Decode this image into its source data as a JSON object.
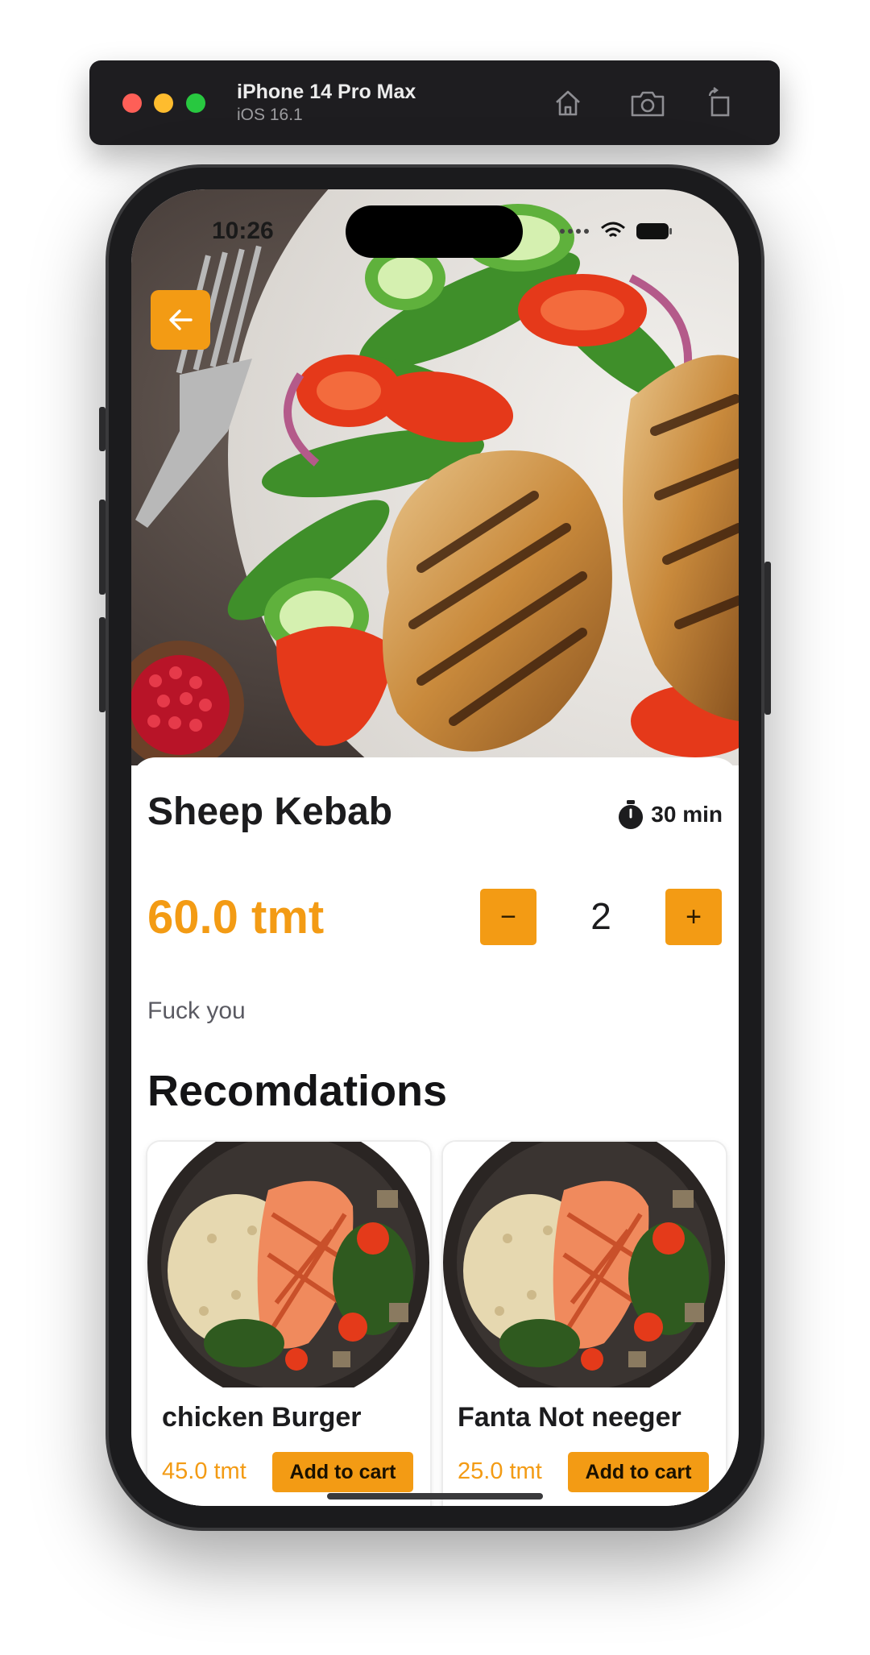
{
  "simulator": {
    "device_name": "iPhone 14 Pro Max",
    "os_version": "iOS 16.1",
    "buttons": [
      "home-icon",
      "screenshot-icon",
      "rotate-icon"
    ]
  },
  "status_bar": {
    "time": "10:26"
  },
  "header": {
    "back_icon": "arrow-left-icon"
  },
  "product": {
    "name": "Sheep Kebab",
    "cook_time": "30 min",
    "price": "60.0 tmt",
    "quantity": "2",
    "minus_label": "−",
    "plus_label": "+",
    "description": "Fuck you"
  },
  "recommendations": {
    "title": "Recomdations",
    "items": [
      {
        "name": "chicken Burger",
        "price": "45.0 tmt",
        "button_label": "Add to cart"
      },
      {
        "name": "Fanta Not neeger",
        "price": "25.0 tmt",
        "button_label": "Add to cart"
      }
    ]
  },
  "colors": {
    "accent": "#f39b14",
    "text_dark": "#1c1c1e",
    "sim_bar": "#1e1d20"
  }
}
